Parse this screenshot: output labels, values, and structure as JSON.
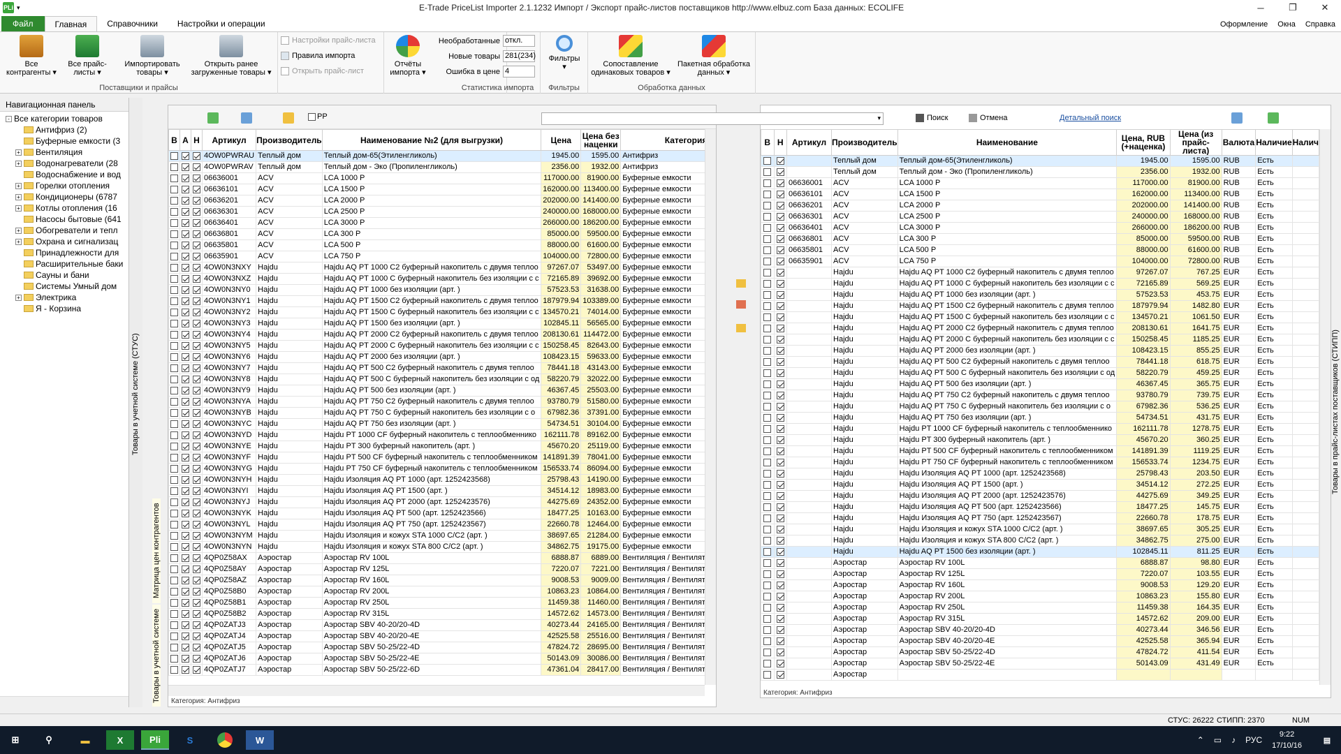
{
  "app": {
    "title": "E-Trade PriceList Importer 2.1.1232     Импорт / Экспорт прайс-листов поставщиков     http://www.elbuz.com     База данных: ECOLIFE",
    "logo": "PLi"
  },
  "tabs": {
    "file": "Файл",
    "main": "Главная",
    "ref": "Справочники",
    "settings": "Настройки и операции",
    "right": [
      "Оформление",
      "Окна",
      "Справка"
    ]
  },
  "ribbon": {
    "all_contractors": "Все контрагенты",
    "all_pricelists": "Все прайс-листы",
    "import_goods": "Импортировать товары",
    "open_loaded": "Открыть ранее загруженные товары",
    "group_suppliers": "Поставщики и прайсы",
    "pl_settings": "Настройки прайс-листа",
    "import_rules": "Правила импорта",
    "open_pl": "Открыть прайс-лист",
    "import_reports": "Отчёты импорта",
    "group_stats": "Статистика импорта",
    "stat_unprocessed_label": "Необработанные",
    "stat_unprocessed_value": "откл.",
    "stat_new_label": "Новые товары",
    "stat_new_value": "281(234)",
    "stat_err_label": "Ошибка в цене",
    "stat_err_value": "4",
    "filters": "Фильтры",
    "group_filters": "Фильтры",
    "match_same": "Сопоставление одинаковых товаров",
    "batch": "Пакетная обработка данных",
    "group_processing": "Обработка данных"
  },
  "nav": {
    "title": "Навигационная панель",
    "items": [
      {
        "label": "Все категории товаров",
        "level": 0,
        "exp": "-"
      },
      {
        "label": "Антифриз (2)",
        "level": 1,
        "exp": ""
      },
      {
        "label": "Буферные емкости (3",
        "level": 1,
        "exp": ""
      },
      {
        "label": "Вентиляция",
        "level": 1,
        "exp": "+"
      },
      {
        "label": "Водонагреватели (28",
        "level": 1,
        "exp": "+"
      },
      {
        "label": "Водоснабжение и вод",
        "level": 1,
        "exp": ""
      },
      {
        "label": "Горелки отопления",
        "level": 1,
        "exp": "+"
      },
      {
        "label": "Кондиционеры (6787",
        "level": 1,
        "exp": "+"
      },
      {
        "label": "Котлы отопления (16",
        "level": 1,
        "exp": "+"
      },
      {
        "label": "Насосы бытовые (641",
        "level": 1,
        "exp": ""
      },
      {
        "label": "Обогреватели и тепл",
        "level": 1,
        "exp": "+"
      },
      {
        "label": "Охрана и сигнализац",
        "level": 1,
        "exp": "+"
      },
      {
        "label": "Принадлежности для",
        "level": 1,
        "exp": ""
      },
      {
        "label": "Расширительные баки",
        "level": 1,
        "exp": ""
      },
      {
        "label": "Сауны и бани",
        "level": 1,
        "exp": ""
      },
      {
        "label": "Системы Умный дом",
        "level": 1,
        "exp": ""
      },
      {
        "label": "Электрика",
        "level": 1,
        "exp": "+"
      },
      {
        "label": "Я - Корзина",
        "level": 1,
        "exp": ""
      }
    ]
  },
  "vtabs": {
    "left_top": "Товары в учетной системе (СТУС)",
    "left_mid": "Матрица цен контрагентов",
    "left_bot": "Товары в учетной системе",
    "right": "Товары в прайс-листах поставщиков (СТИПП)"
  },
  "left": {
    "pp_label": "PP",
    "headers": [
      "В",
      "А",
      "Н",
      "Артикул",
      "Производитель",
      "Наименование №2 (для выгрузки)",
      "Цена",
      "Цена без наценки",
      "Категория"
    ],
    "category": "Категория: Антифриз"
  },
  "right": {
    "search": "Поиск",
    "cancel": "Отмена",
    "detail": "Детальный поиск",
    "headers": [
      "В",
      "Н",
      "Артикул",
      "Производитель",
      "Наименование",
      "Цена, RUB (+наценка)",
      "Цена (из прайс-листа)",
      "Валюта",
      "Наличие",
      "Налич"
    ],
    "category": "Категория: Антифриз"
  },
  "rows": [
    [
      "4OW0PWRAU",
      "Теплый дом",
      "Теплый дом-65(Этиленгликоль)",
      "1945.00",
      "1595.00",
      "Антифриз",
      "",
      "Теплый дом-65(Этиленгликоль)",
      "1945.00",
      "1595.00",
      "RUB",
      "Есть",
      1,
      0,
      0
    ],
    [
      "4OW0PWRAV",
      "Теплый дом",
      "Теплый дом - Эко (Пропиленгликоль)",
      "2356.00",
      "1932.00",
      "Антифриз",
      "",
      "Теплый дом - Эко (Пропиленгликоль)",
      "2356.00",
      "1932.00",
      "RUB",
      "Есть",
      0,
      1,
      0
    ],
    [
      "06636001",
      "ACV",
      "LCA 1000 P",
      "117000.00",
      "81900.00",
      "Буферные емкости",
      "06636001",
      "LCA 1000 P",
      "117000.00",
      "81900.00",
      "RUB",
      "Есть",
      0,
      1,
      0
    ],
    [
      "06636101",
      "ACV",
      "LCA 1500 P",
      "162000.00",
      "113400.00",
      "Буферные емкости",
      "06636101",
      "LCA 1500 P",
      "162000.00",
      "113400.00",
      "RUB",
      "Есть",
      0,
      1,
      0
    ],
    [
      "06636201",
      "ACV",
      "LCA 2000 P",
      "202000.00",
      "141400.00",
      "Буферные емкости",
      "06636201",
      "LCA 2000 P",
      "202000.00",
      "141400.00",
      "RUB",
      "Есть",
      0,
      1,
      0
    ],
    [
      "06636301",
      "ACV",
      "LCA 2500 P",
      "240000.00",
      "168000.00",
      "Буферные емкости",
      "06636301",
      "LCA 2500 P",
      "240000.00",
      "168000.00",
      "RUB",
      "Есть",
      0,
      1,
      0
    ],
    [
      "06636401",
      "ACV",
      "LCA 3000 P",
      "266000.00",
      "186200.00",
      "Буферные емкости",
      "06636401",
      "LCA 3000 P",
      "266000.00",
      "186200.00",
      "RUB",
      "Есть",
      0,
      1,
      0
    ],
    [
      "06636801",
      "ACV",
      "LCA 300 P",
      "85000.00",
      "59500.00",
      "Буферные емкости",
      "06636801",
      "LCA 300 P",
      "85000.00",
      "59500.00",
      "RUB",
      "Есть",
      0,
      1,
      0
    ],
    [
      "06635801",
      "ACV",
      "LCA 500 P",
      "88000.00",
      "61600.00",
      "Буферные емкости",
      "06635801",
      "LCA 500 P",
      "88000.00",
      "61600.00",
      "RUB",
      "Есть",
      0,
      1,
      0
    ],
    [
      "06635901",
      "ACV",
      "LCA 750 P",
      "104000.00",
      "72800.00",
      "Буферные емкости",
      "06635901",
      "LCA 750 P",
      "104000.00",
      "72800.00",
      "RUB",
      "Есть",
      0,
      1,
      0
    ],
    [
      "4OW0N3NXY",
      "Hajdu",
      "Hajdu AQ PT 1000 C2 буферный накопитель с двумя теплоо",
      "97267.07",
      "53497.00",
      "Буферные емкости",
      "",
      "Hajdu AQ PT 1000 C2 буферный накопитель с двумя теплоо",
      "97267.07",
      "767.25",
      "EUR",
      "Есть",
      0,
      1,
      0
    ],
    [
      "4OW0N3NXZ",
      "Hajdu",
      "Hajdu AQ PT 1000 C буферный накопитель без изоляции с с",
      "72165.89",
      "39692.00",
      "Буферные емкости",
      "",
      "Hajdu AQ PT 1000 C буферный накопитель без изоляции с с",
      "72165.89",
      "569.25",
      "EUR",
      "Есть",
      0,
      1,
      0
    ],
    [
      "4OW0N3NY0",
      "Hajdu",
      "Hajdu AQ PT 1000 без изоляции (арт. )",
      "57523.53",
      "31638.00",
      "Буферные емкости",
      "",
      "Hajdu AQ PT 1000 без изоляции (арт. )",
      "57523.53",
      "453.75",
      "EUR",
      "Есть",
      0,
      1,
      0
    ],
    [
      "4OW0N3NY1",
      "Hajdu",
      "Hajdu AQ PT 1500 C2 буферный накопитель с двумя теплоо",
      "187979.94",
      "103389.00",
      "Буферные емкости",
      "",
      "Hajdu AQ PT 1500 C2 буферный накопитель с двумя теплоо",
      "187979.94",
      "1482.80",
      "EUR",
      "Есть",
      0,
      1,
      0
    ],
    [
      "4OW0N3NY2",
      "Hajdu",
      "Hajdu AQ PT 1500 C буферный накопитель без изоляции с с",
      "134570.21",
      "74014.00",
      "Буферные емкости",
      "",
      "Hajdu AQ PT 1500 C буферный накопитель без изоляции с с",
      "134570.21",
      "1061.50",
      "EUR",
      "Есть",
      0,
      1,
      0
    ],
    [
      "4OW0N3NY3",
      "Hajdu",
      "Hajdu AQ PT 1500 без изоляции (арт. )",
      "102845.11",
      "56565.00",
      "Буферные емкости",
      "",
      "Hajdu AQ PT 2000 C2 буферный накопитель с двумя теплоо",
      "208130.61",
      "1641.75",
      "EUR",
      "Есть",
      0,
      1,
      0
    ],
    [
      "4OW0N3NY4",
      "Hajdu",
      "Hajdu AQ PT 2000 C2 буферный накопитель с двумя теплоо",
      "208130.61",
      "114472.00",
      "Буферные емкости",
      "",
      "Hajdu AQ PT 2000 C буферный накопитель без изоляции с с",
      "150258.45",
      "1185.25",
      "EUR",
      "Есть",
      0,
      1,
      0
    ],
    [
      "4OW0N3NY5",
      "Hajdu",
      "Hajdu AQ PT 2000 C буферный накопитель без изоляции с с",
      "150258.45",
      "82643.00",
      "Буферные емкости",
      "",
      "Hajdu AQ PT 2000 без изоляции (арт. )",
      "108423.15",
      "855.25",
      "EUR",
      "Есть",
      0,
      1,
      0
    ],
    [
      "4OW0N3NY6",
      "Hajdu",
      "Hajdu AQ PT 2000 без изоляции (арт. )",
      "108423.15",
      "59633.00",
      "Буферные емкости",
      "",
      "Hajdu AQ PT  500 C2 буферный накопитель с двумя теплоо",
      "78441.18",
      "618.75",
      "EUR",
      "Есть",
      0,
      1,
      0
    ],
    [
      "4OW0N3NY7",
      "Hajdu",
      "Hajdu AQ PT  500 C2 буферный накопитель с двумя теплоо",
      "78441.18",
      "43143.00",
      "Буферные емкости",
      "",
      "Hajdu AQ PT 500 C буферный накопитель без изоляции с од",
      "58220.79",
      "459.25",
      "EUR",
      "Есть",
      0,
      1,
      0
    ],
    [
      "4OW0N3NY8",
      "Hajdu",
      "Hajdu AQ PT 500 C буферный накопитель без изоляции с од",
      "58220.79",
      "32022.00",
      "Буферные емкости",
      "",
      "Hajdu AQ PT 500 без изоляции (арт. )",
      "46367.45",
      "365.75",
      "EUR",
      "Есть",
      0,
      1,
      0
    ],
    [
      "4OW0N3NY9",
      "Hajdu",
      "Hajdu AQ PT 500 без изоляции (арт. )",
      "46367.45",
      "25503.00",
      "Буферные емкости",
      "",
      "Hajdu AQ PT  750 C2 буферный накопитель с двумя теплоо",
      "93780.79",
      "739.75",
      "EUR",
      "Есть",
      0,
      1,
      0
    ],
    [
      "4OW0N3NYA",
      "Hajdu",
      "Hajdu AQ PT  750 C2 буферный накопитель с двумя теплоо",
      "93780.79",
      "51580.00",
      "Буферные емкости",
      "",
      "Hajdu AQ PT  750 C буферный накопитель без изоляции с о",
      "67982.36",
      "536.25",
      "EUR",
      "Есть",
      0,
      1,
      0
    ],
    [
      "4OW0N3NYB",
      "Hajdu",
      "Hajdu AQ PT  750 C буферный накопитель без изоляции с о",
      "67982.36",
      "37391.00",
      "Буферные емкости",
      "",
      "Hajdu AQ PT 750 без изоляции (арт. )",
      "54734.51",
      "431.75",
      "EUR",
      "Есть",
      0,
      1,
      0
    ],
    [
      "4OW0N3NYC",
      "Hajdu",
      "Hajdu AQ PT 750 без изоляции (арт. )",
      "54734.51",
      "30104.00",
      "Буферные емкости",
      "",
      "Hajdu PT 1000 CF буферный накопитель с теплообменникo",
      "162111.78",
      "1278.75",
      "EUR",
      "Есть",
      0,
      1,
      0
    ],
    [
      "4OW0N3NYD",
      "Hajdu",
      "Hajdu PT 1000 CF буферный накопитель с теплообменникo",
      "162111.78",
      "89162.00",
      "Буферные емкости",
      "",
      "Hajdu PT 300 буферный накопитель (арт. )",
      "45670.20",
      "360.25",
      "EUR",
      "Есть",
      0,
      1,
      0
    ],
    [
      "4OW0N3NYE",
      "Hajdu",
      "Hajdu PT 300 буферный накопитель (арт. )",
      "45670.20",
      "25119.00",
      "Буферные емкости",
      "",
      "Hajdu PT 500 CF буферный накопитель с теплообменником",
      "141891.39",
      "1119.25",
      "EUR",
      "Есть",
      0,
      1,
      0
    ],
    [
      "4OW0N3NYF",
      "Hajdu",
      "Hajdu PT 500 CF буферный накопитель с теплообменником",
      "141891.39",
      "78041.00",
      "Буферные емкости",
      "",
      "Hajdu PT 750 CF буферный накопитель с теплообменником",
      "156533.74",
      "1234.75",
      "EUR",
      "Есть",
      0,
      1,
      0
    ],
    [
      "4OW0N3NYG",
      "Hajdu",
      "Hajdu PT 750 CF буферный накопитель с теплообменником",
      "156533.74",
      "86094.00",
      "Буферные емкости",
      "",
      "Hajdu Изоляция AQ PT 1000 (арт. 1252423568)",
      "25798.43",
      "203.50",
      "EUR",
      "Есть",
      0,
      1,
      0
    ],
    [
      "4OW0N3NYH",
      "Hajdu",
      "Hajdu Изоляция AQ PT 1000 (арт. 1252423568)",
      "25798.43",
      "14190.00",
      "Буферные емкости",
      "",
      "Hajdu Изоляция AQ PT 1500 (арт. )",
      "34514.12",
      "272.25",
      "EUR",
      "Есть",
      0,
      1,
      0
    ],
    [
      "4OW0N3NYI",
      "Hajdu",
      "Hajdu Изоляция AQ PT 1500 (арт. )",
      "34514.12",
      "18983.00",
      "Буферные емкости",
      "",
      "Hajdu Изоляция AQ PT 2000 (арт. 1252423576)",
      "44275.69",
      "349.25",
      "EUR",
      "Есть",
      0,
      1,
      0
    ],
    [
      "4OW0N3NYJ",
      "Hajdu",
      "Hajdu Изоляция AQ PT 2000 (арт. 1252423576)",
      "44275.69",
      "24352.00",
      "Буферные емкости",
      "",
      "Hajdu Изоляция AQ PT  500 (арт. 1252423566)",
      "18477.25",
      "145.75",
      "EUR",
      "Есть",
      0,
      1,
      0
    ],
    [
      "4OW0N3NYK",
      "Hajdu",
      "Hajdu Изоляция AQ PT  500 (арт. 1252423566)",
      "18477.25",
      "10163.00",
      "Буферные емкости",
      "",
      "Hajdu Изоляция AQ PT  750 (арт. 1252423567)",
      "22660.78",
      "178.75",
      "EUR",
      "Есть",
      0,
      1,
      0
    ],
    [
      "4OW0N3NYL",
      "Hajdu",
      "Hajdu Изоляция AQ PT  750 (арт. 1252423567)",
      "22660.78",
      "12464.00",
      "Буферные емкости",
      "",
      "Hajdu Изоляция и кожух STA 1000 C/C2 (арт. )",
      "38697.65",
      "305.25",
      "EUR",
      "Есть",
      0,
      1,
      0
    ],
    [
      "4OW0N3NYM",
      "Hajdu",
      "Hajdu Изоляция и кожух STA 1000 C/C2 (арт. )",
      "38697.65",
      "21284.00",
      "Буферные емкости",
      "",
      "Hajdu Изоляция и кожух STA  800 C/C2 (арт. )",
      "34862.75",
      "275.00",
      "EUR",
      "Есть",
      0,
      1,
      0
    ],
    [
      "4OW0N3NYN",
      "Hajdu",
      "Hajdu Изоляция и кожух STA  800 C/C2 (арт. )",
      "34862.75",
      "19175.00",
      "Буферные емкости",
      "",
      "Hajdu AQ PT 1500 без изоляции (арт. )",
      "102845.11",
      "811.25",
      "EUR",
      "Есть",
      0,
      1,
      1
    ],
    [
      "4QP0Z58AX",
      "Аэростар",
      "Аэростар RV 100L",
      "6888.87",
      "6889.00",
      "Вентиляция / Вентиляторы для кру",
      "",
      "Аэростар RV 100L",
      "6888.87",
      "98.80",
      "EUR",
      "Есть",
      0,
      1,
      0
    ],
    [
      "4QP0Z58AY",
      "Аэростар",
      "Аэростар RV 125L",
      "7220.07",
      "7221.00",
      "Вентиляция / Вентиляторы для кру",
      "",
      "Аэростар RV 125L",
      "7220.07",
      "103.55",
      "EUR",
      "Есть",
      0,
      1,
      0
    ],
    [
      "4QP0Z58AZ",
      "Аэростар",
      "Аэростар RV 160L",
      "9008.53",
      "9009.00",
      "Вентиляция / Вентиляторы для кру",
      "",
      "Аэростар RV 160L",
      "9008.53",
      "129.20",
      "EUR",
      "Есть",
      0,
      1,
      0
    ],
    [
      "4QP0Z58B0",
      "Аэростар",
      "Аэростар RV 200L",
      "10863.23",
      "10864.00",
      "Вентиляция / Вентиляторы для кру",
      "",
      "Аэростар RV 200L",
      "10863.23",
      "155.80",
      "EUR",
      "Есть",
      0,
      1,
      0
    ],
    [
      "4QP0Z58B1",
      "Аэростар",
      "Аэростар RV 250L",
      "11459.38",
      "11460.00",
      "Вентиляция / Вентиляторы для кру",
      "",
      "Аэростар RV 250L",
      "11459.38",
      "164.35",
      "EUR",
      "Есть",
      0,
      1,
      0
    ],
    [
      "4QP0Z58B2",
      "Аэростар",
      "Аэростар RV 315L",
      "14572.62",
      "14573.00",
      "Вентиляция / Вентиляторы для кру",
      "",
      "Аэростар RV 315L",
      "14572.62",
      "209.00",
      "EUR",
      "Есть",
      0,
      1,
      0
    ],
    [
      "4QP0ZATJ3",
      "Аэростар",
      "Аэростар SBV 40-20/20-4D",
      "40273.44",
      "24165.00",
      "Вентиляция / Вентиляторы для пря",
      "",
      "Аэростар SBV 40-20/20-4D",
      "40273.44",
      "346.56",
      "EUR",
      "Есть",
      0,
      1,
      0
    ],
    [
      "4QP0ZATJ4",
      "Аэростар",
      "Аэростар SBV  40-20/20-4E",
      "42525.58",
      "25516.00",
      "Вентиляция / Вентиляторы для пря",
      "",
      "Аэростар SBV  40-20/20-4E",
      "42525.58",
      "365.94",
      "EUR",
      "Есть",
      0,
      1,
      0
    ],
    [
      "4QP0ZATJ5",
      "Аэростар",
      "Аэростар SBV  50-25/22-4D",
      "47824.72",
      "28695.00",
      "Вентиляция / Вентиляторы для пря",
      "",
      "Аэростар SBV  50-25/22-4D",
      "47824.72",
      "411.54",
      "EUR",
      "Есть",
      0,
      1,
      0
    ],
    [
      "4QP0ZATJ6",
      "Аэростар",
      "Аэростар SBV  50-25/22-4E",
      "50143.09",
      "30086.00",
      "Вентиляция / Вентиляторы для пря",
      "",
      "Аэростар SBV  50-25/22-4E",
      "50143.09",
      "431.49",
      "EUR",
      "Есть",
      0,
      1,
      0
    ],
    [
      "4QP0ZATJ7",
      "Аэростар",
      "Аэростар SBV  50-25/22-6D",
      "47361.04",
      "28417.00",
      "Вентиляция / Вентиляторы для пря",
      "",
      "",
      "",
      "",
      "",
      "",
      0,
      1,
      0
    ]
  ],
  "status": {
    "stus": "СТУС: 26222",
    "stipp": "СТИПП: 2370",
    "num": "NUM"
  },
  "taskbar": {
    "lang": "РУС",
    "time": "9:22",
    "date": "17/10/16"
  },
  "colors": {
    "file_tab": "#2f8a2f",
    "price_highlight": "#fdf8c8",
    "selected_row": "#dceeff",
    "taskbar": "#101b2a"
  }
}
